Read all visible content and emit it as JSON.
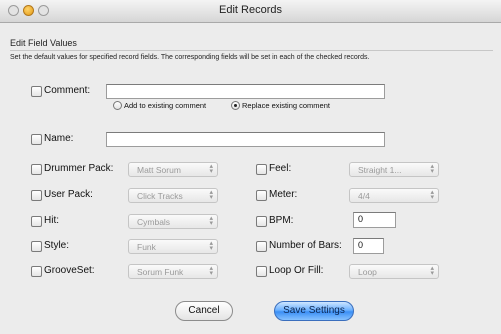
{
  "window": {
    "title": "Edit Records"
  },
  "header": {
    "section_label": "Edit Field Values",
    "description": "Set the default values for specified record fields. The corresponding fields will be set in each of the checked records."
  },
  "comment": {
    "label": "Comment:",
    "value": "",
    "checked": false,
    "options": [
      {
        "label": "Add to existing comment",
        "selected": false
      },
      {
        "label": "Replace existing comment",
        "selected": true
      }
    ]
  },
  "name": {
    "label": "Name:",
    "value": "",
    "checked": false
  },
  "left_fields": [
    {
      "label": "Drummer Pack:",
      "value": "Matt Sorum",
      "checked": false
    },
    {
      "label": "User Pack:",
      "value": "Click Tracks",
      "checked": false
    },
    {
      "label": "Hit:",
      "value": "Cymbals",
      "checked": false
    },
    {
      "label": "Style:",
      "value": "Funk",
      "checked": false
    },
    {
      "label": "GrooveSet:",
      "value": "Sorum Funk",
      "checked": false
    }
  ],
  "right_fields": {
    "feel": {
      "label": "Feel:",
      "value": "Straight 1...",
      "checked": false
    },
    "meter": {
      "label": "Meter:",
      "value": "4/4",
      "checked": false
    },
    "bpm": {
      "label": "BPM:",
      "value": "0",
      "checked": false
    },
    "bars": {
      "label": "Number of Bars:",
      "value": "0",
      "checked": false
    },
    "loop": {
      "label": "Loop Or Fill:",
      "value": "Loop",
      "checked": false
    }
  },
  "buttons": {
    "cancel": "Cancel",
    "save": "Save Settings"
  },
  "icons": {
    "popup_arrows": "updown-arrows-icon"
  }
}
